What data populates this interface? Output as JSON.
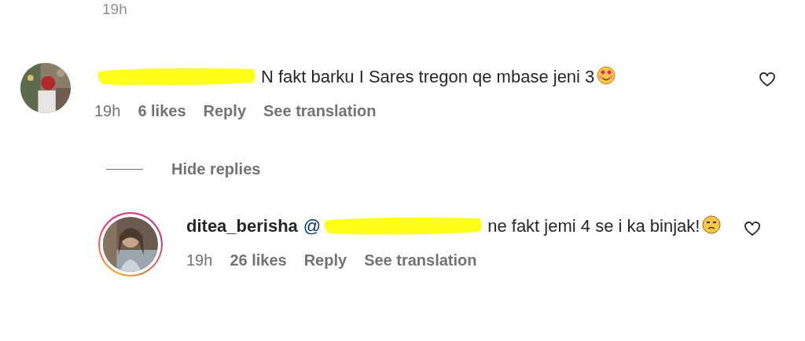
{
  "previous_time": "19h",
  "comments": [
    {
      "story_ring": false,
      "liked": false,
      "parts": [
        {
          "kind": "redacted"
        },
        {
          "kind": "text",
          "text": "N fakt barku I Sares tregon qe mbase jeni 3"
        },
        {
          "kind": "emoji_smiling_hearts"
        }
      ],
      "time": "19h",
      "likes": "6 likes",
      "reply": "Reply",
      "translate": "See translation",
      "hide_replies": "Hide replies",
      "replies": [
        {
          "story_ring": true,
          "liked": false,
          "author": "ditea_berisha",
          "parts": [
            {
              "kind": "mention",
              "text": "@"
            },
            {
              "kind": "redacted"
            },
            {
              "kind": "text",
              "text": "ne fakt jemi 4 se i ka binjak!"
            },
            {
              "kind": "emoji_unamused"
            }
          ],
          "time": "19h",
          "likes": "26 likes",
          "reply": "Reply",
          "translate": "See translation"
        }
      ]
    }
  ]
}
